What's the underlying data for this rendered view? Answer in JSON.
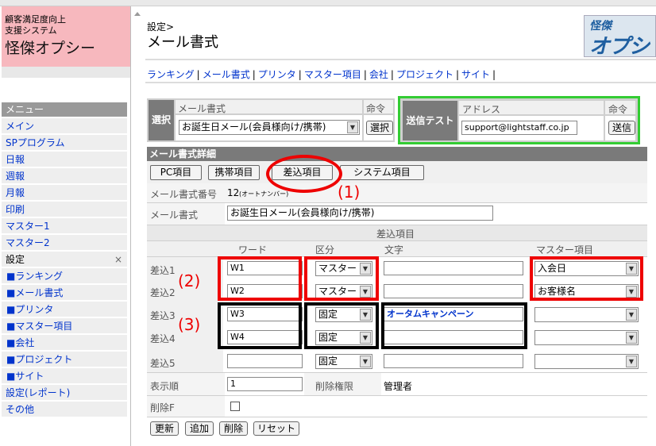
{
  "sidebar": {
    "brand_line1": "顧客満足度向上",
    "brand_line2": "支援システム",
    "brand_name": "怪傑オプシー",
    "menu_header": "メニュー",
    "items": [
      {
        "label": "メイン"
      },
      {
        "label": "SPプログラム"
      },
      {
        "label": "日報"
      },
      {
        "label": "週報"
      },
      {
        "label": "月報"
      },
      {
        "label": "印刷"
      },
      {
        "label": "マスター1"
      },
      {
        "label": "マスター2"
      },
      {
        "label": "設定"
      },
      {
        "label": "■ランキング"
      },
      {
        "label": "■メール書式"
      },
      {
        "label": "■プリンタ"
      },
      {
        "label": "■マスター項目"
      },
      {
        "label": "■会社"
      },
      {
        "label": "■プロジェクト"
      },
      {
        "label": "■サイト"
      },
      {
        "label": "設定(レポート)"
      },
      {
        "label": "その他"
      }
    ],
    "close_glyph": "×"
  },
  "header": {
    "breadcrumb": "設定>",
    "title": "メール書式",
    "logo_line1": "怪傑",
    "logo_line2": "オプシ"
  },
  "nav": {
    "links": [
      "ランキング",
      "メール書式",
      "プリンタ",
      "マスター項目",
      "会社",
      "プロジェクト",
      "サイト"
    ],
    "separator": "|"
  },
  "select_panel": {
    "label": "選択",
    "col_mail": "メール書式",
    "col_cmd": "命令",
    "selected_template": "お誕生日メール(会員様向け/携帯)",
    "select_button": "選択"
  },
  "send_test": {
    "label": "送信テスト",
    "col_address": "アドレス",
    "col_cmd": "命令",
    "address": "support@lightstaff.co.jp",
    "send_button": "送信"
  },
  "detail": {
    "section_title": "メール書式詳細",
    "tabs": [
      "PC項目",
      "携帯項目",
      "差込項目",
      "システム項目"
    ],
    "number_label": "メール書式番号",
    "number_value": "12",
    "number_note": "(オートナンバー)",
    "name_label": "メール書式",
    "name_value": "お誕生日メール(会員様向け/携帯)",
    "insert_header": "差込項目",
    "col_word": "ワード",
    "col_kubun": "区分",
    "col_text": "文字",
    "col_master": "マスター項目",
    "rows": [
      {
        "label": "差込1",
        "word": "W1",
        "kubun": "マスター",
        "text": "",
        "master": "入会日"
      },
      {
        "label": "差込2",
        "word": "W2",
        "kubun": "マスター",
        "text": "",
        "master": "お客様名"
      },
      {
        "label": "差込3",
        "word": "W3",
        "kubun": "固定",
        "text": "オータムキャンペーン",
        "master": ""
      },
      {
        "label": "差込4",
        "word": "W4",
        "kubun": "固定",
        "text": "",
        "master": ""
      },
      {
        "label": "差込5",
        "word": "",
        "kubun": "固定",
        "text": "",
        "master": ""
      }
    ],
    "order_label": "表示順",
    "order_value": "1",
    "perm_label": "削除権限",
    "perm_value": "管理者",
    "delete_flag_label": "削除F",
    "buttons": [
      "更新",
      "追加",
      "削除",
      "リセット"
    ]
  },
  "annotations": [
    "(1)",
    "(2)",
    "(3)"
  ],
  "colors": {
    "highlight_red": "#ee0000",
    "highlight_green": "#33cc33",
    "highlight_black": "#000000",
    "brand_bg": "#f7b8be",
    "link": "#0033cc"
  }
}
